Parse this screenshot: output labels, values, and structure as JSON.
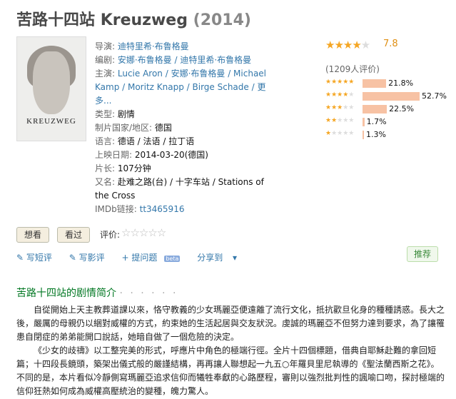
{
  "movie": {
    "cn_title": "苦路十四站",
    "en_title": "Kreuzweg",
    "year": "(2014)"
  },
  "poster": {
    "title": "KREUZWEG"
  },
  "info": [
    {
      "key": "导演: ",
      "val": "迪特里希·布鲁格曼",
      "link": true
    },
    {
      "key": "编剧: ",
      "val": "安娜·布鲁格曼 / 迪特里希·布鲁格曼",
      "link": true
    },
    {
      "key": "主演: ",
      "val": "Lucie Aron / 安娜·布鲁格曼 / Michael Kamp / Moritz Knapp / Birge Schade / 更多...",
      "link": true
    },
    {
      "key": "类型: ",
      "val": "剧情",
      "link": false
    },
    {
      "key": "制片国家/地区: ",
      "val": "德国",
      "link": false
    },
    {
      "key": "语言: ",
      "val": "德语 / 法语 / 拉丁语",
      "link": false
    },
    {
      "key": "上映日期: ",
      "val": "2014-03-20(德国)",
      "link": false
    },
    {
      "key": "片长: ",
      "val": "107分钟",
      "link": false
    },
    {
      "key": "又名: ",
      "val": "赴难之路(台) / 十字车站 / Stations of the Cross",
      "link": false
    },
    {
      "key": "IMDb链接: ",
      "val": "tt3465916",
      "link": true
    }
  ],
  "rating": {
    "score": "7.8",
    "stars_filled": 4,
    "votes": "(1209人评价)",
    "breakdown": [
      {
        "stars": 5,
        "percent": "21.8%",
        "value": 21.8
      },
      {
        "stars": 4,
        "percent": "52.7%",
        "value": 52.7
      },
      {
        "stars": 3,
        "percent": "22.5%",
        "value": 22.5
      },
      {
        "stars": 2,
        "percent": "1.7%",
        "value": 1.7
      },
      {
        "stars": 1,
        "percent": "1.3%",
        "value": 1.3
      }
    ]
  },
  "buttons": {
    "want": "想看",
    "seen": "看过",
    "rate_label": "评价:"
  },
  "actions": {
    "write_short": "写短评",
    "write_review": "写影评",
    "ask": "提问题",
    "beta": "beta",
    "share": "分享到",
    "recommend": "推荐"
  },
  "summary": {
    "title": "苦路十四站的剧情简介",
    "dots": "· · · · · ·",
    "p1": "自從開始上天主教葬道課以來，恪守教義的少女瑪麗亞便遠離了流行文化，抵抗歡旦化身的種種誘惑。長大之後，嚴厲的母親仍以綑對威權的方式，約束她的生活起居與交友狀況。虔誠的瑪麗亞不但努力達到要求，為了讓罹患自閉症的弟弟能開口說話，她暗自做了一個危險的決定。",
    "p2": "《少女的歧禱》以工整完美的形式，呼應片中角色的極端行徑。全片十四個標題，借典自耶穌赴難的拿回短篇；十四段長鏡頭，築架出儀式般的嚴謹結構，再再讓人聯想起一九五○年羅貝里尼執導的《聖法蘭西斯之花》。不同的是，本片看似冷靜側寫瑪麗亞追求信仰而犧牲奉獻的心路歷程，審則以強烈批判性的諷喻口吻，探討極端的信仰狂熱如何成為威權高壓統治的變種，魄力驚人。"
  }
}
